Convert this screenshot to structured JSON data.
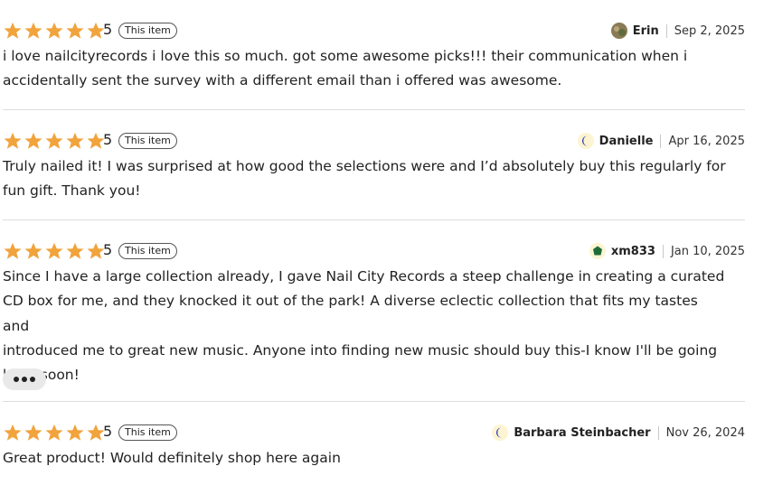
{
  "reviews": [
    {
      "rating": "5",
      "badge": "This item",
      "reviewer": "Erin",
      "avatar_icon": "photo-avatar",
      "date": "Sep 2, 2025",
      "text": "i love nailcityrecords i love this so much. got some awesome picks!!! their communication when i\naccidentally sent the survey with a different email than i offered was awesome."
    },
    {
      "rating": "5",
      "badge": "This item",
      "reviewer": "Danielle",
      "avatar_icon": "moon-avatar-icon",
      "date": "Apr 16, 2025",
      "text": "Truly nailed it! I was surprised at how good the selections were and I’d absolutely buy this regularly for\nfun gift. Thank you!"
    },
    {
      "rating": "5",
      "badge": "This item",
      "reviewer": "xm833",
      "avatar_icon": "leaf-avatar-icon",
      "date": "Jan 10, 2025",
      "text": "Since I have a large collection already, I gave Nail City Records a steep challenge in creating a curated\nCD box for me, and they knocked it out of the park! A diverse eclectic collection that fits my tastes and\nintroduced me to great new music. Anyone into finding new music should buy this-I know I'll be going\nback soon!",
      "more_icon": "more-ellipsis-icon"
    },
    {
      "rating": "5",
      "badge": "This item",
      "reviewer": "Barbara Steinbacher",
      "avatar_icon": "moon-avatar-icon",
      "date": "Nov 26, 2024",
      "text": "Great product! Would definitely shop here again"
    }
  ],
  "colors": {
    "star": "#f1a33c",
    "divider": "#dddddd",
    "moon": "#2c3fb1",
    "leaf": "#1f6b3a",
    "avatar_bg": "#fdf4d2"
  }
}
